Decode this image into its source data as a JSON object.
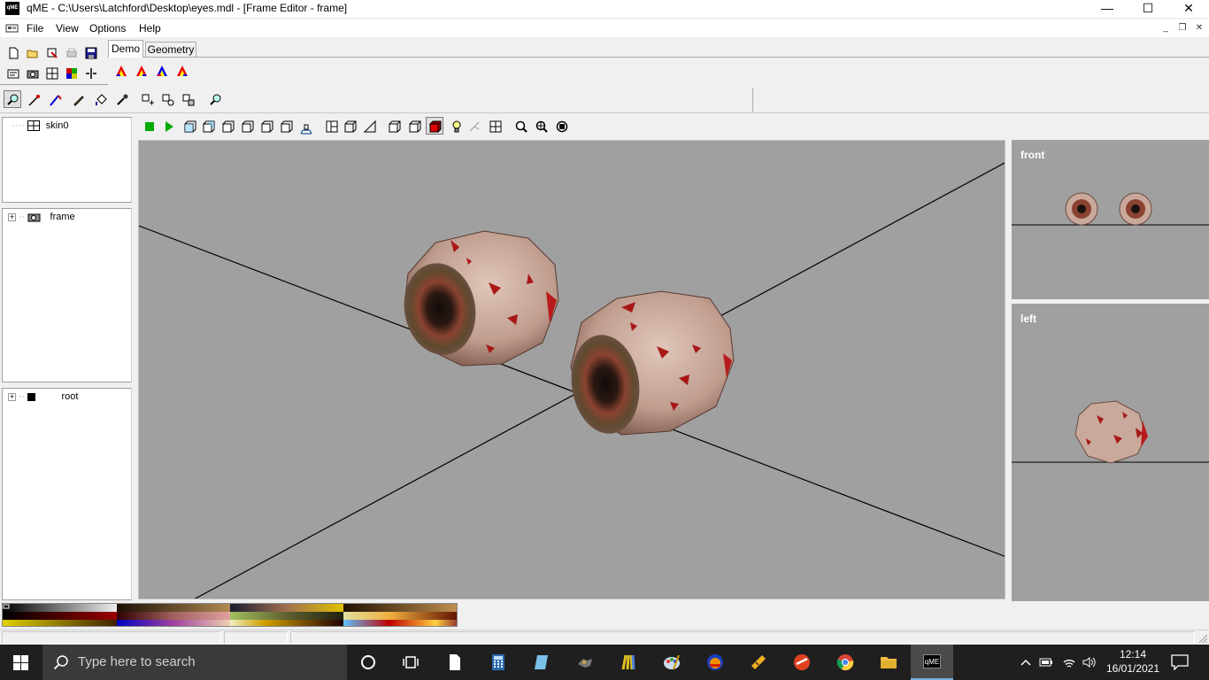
{
  "window": {
    "title": "qME - C:\\Users\\Latchford\\Desktop\\eyes.mdl - [Frame Editor - frame]",
    "app_icon_text": "qME",
    "minimize": "—",
    "maximize": "☐",
    "close": "✕"
  },
  "menu": {
    "items": [
      "File",
      "View",
      "Options",
      "Help"
    ],
    "mdi_minimize": "_",
    "mdi_restore": "❐",
    "mdi_close": "✕"
  },
  "tabs": {
    "demo": "Demo",
    "geometry": "Geometry"
  },
  "tree": {
    "skins": [
      "skin0"
    ],
    "frames": [
      "frame"
    ],
    "root": "root",
    "expander": "+"
  },
  "views": {
    "front_label": "front",
    "left_label": "left"
  },
  "statusbar": {
    "pane1": "",
    "pane2": "",
    "pane3": ""
  },
  "taskbar": {
    "search_placeholder": "Type here to search",
    "active_app_label": "qME",
    "time": "12:14",
    "date": "16/01/2021"
  },
  "colors": {
    "viewport_bg": "#a0a0a0",
    "taskbar_bg": "#1f1f1f",
    "eye_flesh": "#c9a99b",
    "eye_blood": "#a81818",
    "iris": "#7a3a2a",
    "pupil": "#1a1210"
  }
}
